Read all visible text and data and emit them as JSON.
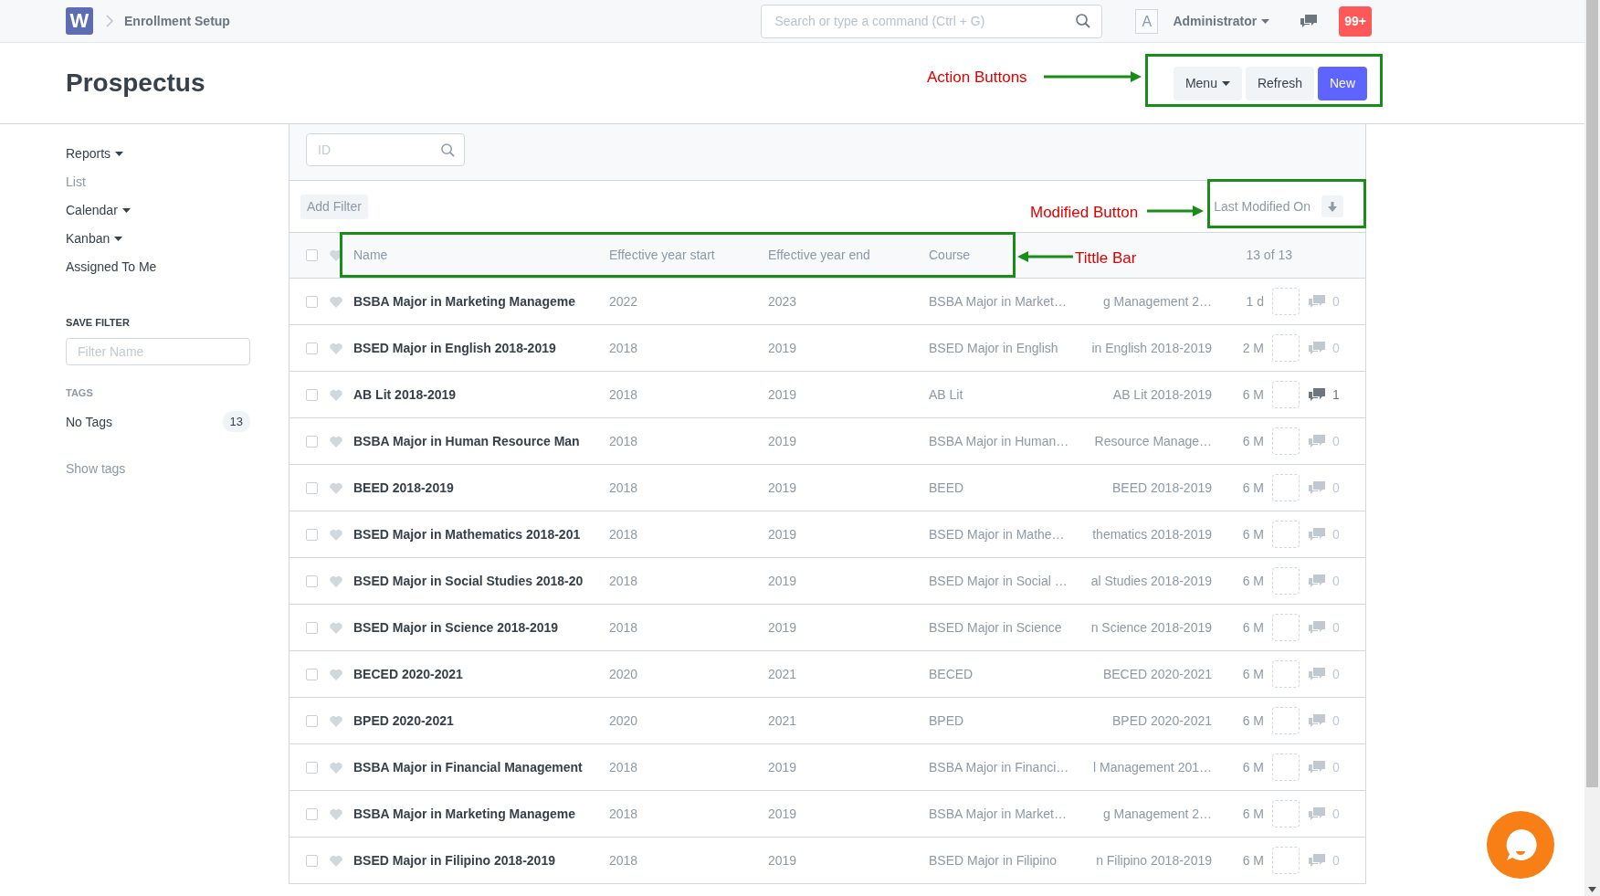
{
  "navbar": {
    "logo": "W",
    "breadcrumb": "Enrollment Setup",
    "search": {
      "placeholder": "Search or type a command (Ctrl + G)"
    },
    "avatar": "A",
    "user": "Administrator",
    "notifications": "99+"
  },
  "page": {
    "title": "Prospectus",
    "buttons": [
      {
        "label": "Menu",
        "kind": "dropdown"
      },
      {
        "label": "Refresh",
        "kind": "default"
      },
      {
        "label": "New",
        "kind": "primary"
      }
    ]
  },
  "sidebar": {
    "items": [
      {
        "label": "Reports",
        "dropdown": true,
        "selected": false
      },
      {
        "label": "List",
        "dropdown": false,
        "selected": true
      },
      {
        "label": "Calendar",
        "dropdown": true,
        "selected": false
      },
      {
        "label": "Kanban",
        "dropdown": true,
        "selected": false
      },
      {
        "label": "Assigned To Me",
        "dropdown": false,
        "selected": false
      }
    ],
    "save_filter": {
      "heading": "SAVE FILTER",
      "placeholder": "Filter Name"
    },
    "tags": {
      "heading": "TAGS",
      "items": [
        {
          "label": "No Tags",
          "count": "13"
        }
      ],
      "show_link": "Show tags"
    }
  },
  "list": {
    "id_filter": {
      "placeholder": "ID"
    },
    "add_filter": "Add Filter",
    "sort": {
      "label": "Last Modified On"
    },
    "select_all": false,
    "columns": [
      "Name",
      "Effective year start",
      "Effective year end",
      "Course"
    ],
    "count": "13 of 13",
    "rows": [
      {
        "name": "BSBA Major in Marketing Manageme",
        "start": "2022",
        "end": "2023",
        "course": "BSBA Major in Market…",
        "title": "g Management 2…",
        "modified": "1 d",
        "comments": "0",
        "has_comments": false,
        "checked": false,
        "liked": false
      },
      {
        "name": "BSED Major in English 2018-2019",
        "start": "2018",
        "end": "2019",
        "course": "BSED Major in English",
        "title": "in English 2018-2019",
        "modified": "2 M",
        "comments": "0",
        "has_comments": false,
        "checked": false,
        "liked": false
      },
      {
        "name": "AB Lit 2018-2019",
        "start": "2018",
        "end": "2019",
        "course": "AB Lit",
        "title": "AB Lit 2018-2019",
        "modified": "6 M",
        "comments": "1",
        "has_comments": true,
        "checked": false,
        "liked": false
      },
      {
        "name": "BSBA Major in Human Resource Man",
        "start": "2018",
        "end": "2019",
        "course": "BSBA Major in Human…",
        "title": "Resource Manage…",
        "modified": "6 M",
        "comments": "0",
        "has_comments": false,
        "checked": false,
        "liked": false
      },
      {
        "name": "BEED 2018-2019",
        "start": "2018",
        "end": "2019",
        "course": "BEED",
        "title": "BEED 2018-2019",
        "modified": "6 M",
        "comments": "0",
        "has_comments": false,
        "checked": false,
        "liked": false
      },
      {
        "name": "BSED Major in Mathematics 2018-201",
        "start": "2018",
        "end": "2019",
        "course": "BSED Major in Mathe…",
        "title": "thematics 2018-2019",
        "modified": "6 M",
        "comments": "0",
        "has_comments": false,
        "checked": false,
        "liked": false
      },
      {
        "name": "BSED Major in Social Studies 2018-20",
        "start": "2018",
        "end": "2019",
        "course": "BSED Major in Social …",
        "title": "al Studies 2018-2019",
        "modified": "6 M",
        "comments": "0",
        "has_comments": false,
        "checked": false,
        "liked": false
      },
      {
        "name": "BSED Major in Science 2018-2019",
        "start": "2018",
        "end": "2019",
        "course": "BSED Major in Science",
        "title": "n Science 2018-2019",
        "modified": "6 M",
        "comments": "0",
        "has_comments": false,
        "checked": false,
        "liked": false
      },
      {
        "name": "BECED 2020-2021",
        "start": "2020",
        "end": "2021",
        "course": "BECED",
        "title": "BECED 2020-2021",
        "modified": "6 M",
        "comments": "0",
        "has_comments": false,
        "checked": false,
        "liked": false
      },
      {
        "name": "BPED 2020-2021",
        "start": "2020",
        "end": "2021",
        "course": "BPED",
        "title": "BPED 2020-2021",
        "modified": "6 M",
        "comments": "0",
        "has_comments": false,
        "checked": false,
        "liked": false
      },
      {
        "name": "BSBA Major in Financial Management",
        "start": "2018",
        "end": "2019",
        "course": "BSBA Major in Financi…",
        "title": "l Management 201…",
        "modified": "6 M",
        "comments": "0",
        "has_comments": false,
        "checked": false,
        "liked": false
      },
      {
        "name": "BSBA Major in Marketing Manageme",
        "start": "2018",
        "end": "2019",
        "course": "BSBA Major in Market…",
        "title": "g Management 2…",
        "modified": "6 M",
        "comments": "0",
        "has_comments": false,
        "checked": false,
        "liked": false
      },
      {
        "name": "BSED Major in Filipino 2018-2019",
        "start": "2018",
        "end": "2019",
        "course": "BSED Major in Filipino",
        "title": "n Filipino 2018-2019",
        "modified": "6 M",
        "comments": "0",
        "has_comments": false,
        "checked": false,
        "liked": false
      }
    ]
  },
  "annotations": [
    {
      "label": "Action Buttons",
      "kind": "actions"
    },
    {
      "label": "Modified Button",
      "kind": "sort"
    },
    {
      "label": "Tittle Bar",
      "kind": "header"
    }
  ]
}
